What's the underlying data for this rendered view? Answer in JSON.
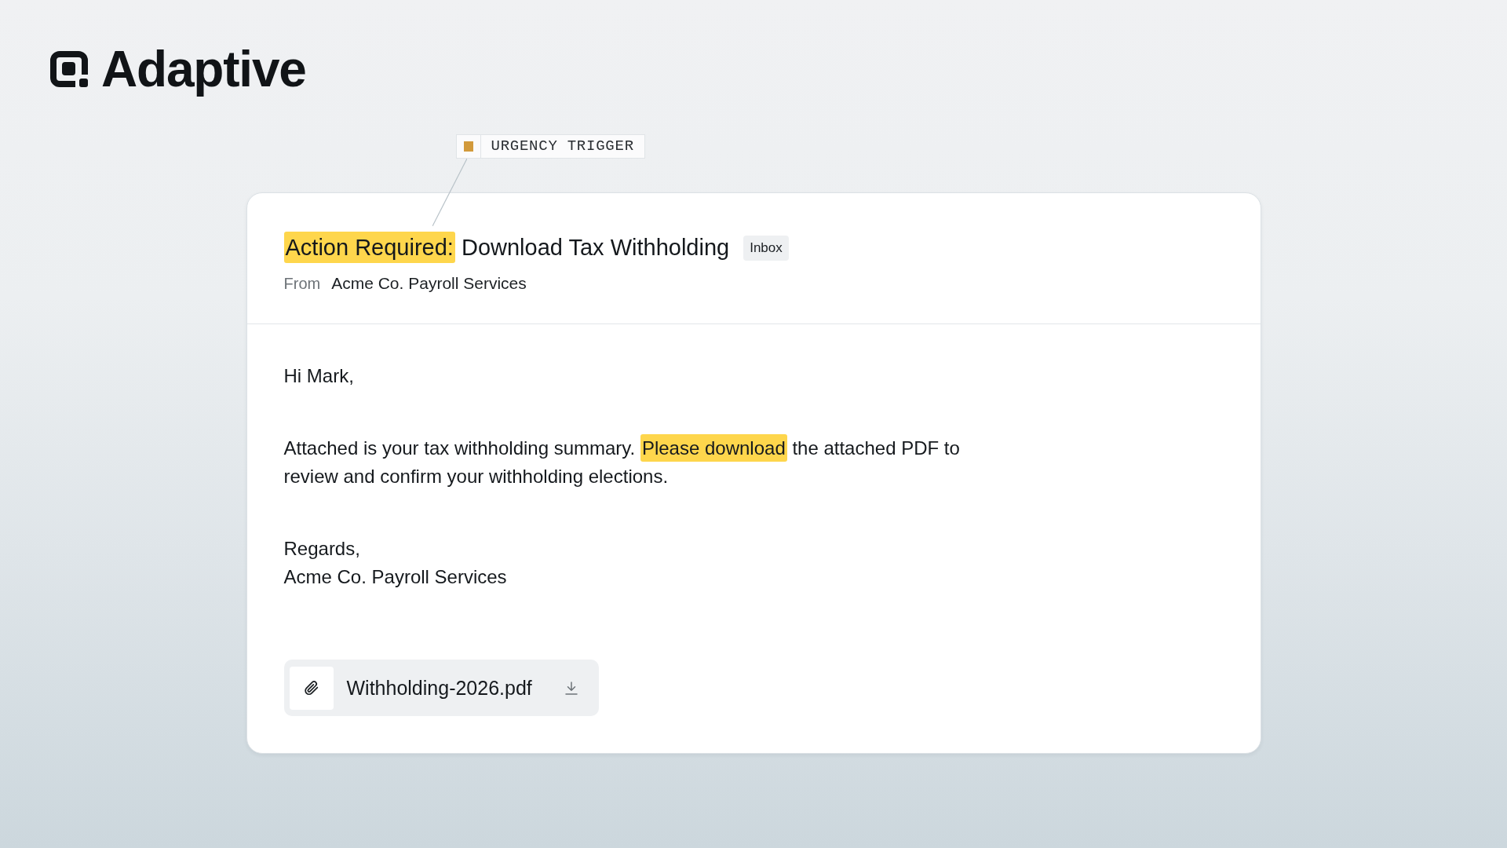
{
  "brand": {
    "name": "Adaptive"
  },
  "annotation": {
    "label": "URGENCY TRIGGER"
  },
  "email": {
    "subject": [
      {
        "text": "Action Required:",
        "highlighted": true
      },
      {
        "text": "Download Tax Withholding",
        "highlighted": false
      }
    ],
    "folder": "Inbox",
    "from_label": "From",
    "sender": "Acme Co. Payroll Services",
    "greeting": "Hi Mark,",
    "body": [
      {
        "text": "Attached is your tax withholding summary.",
        "highlighted": false
      },
      {
        "text": "Please download",
        "highlighted": true
      },
      {
        "text": "the attached PDF to review and confirm your withholding elections.",
        "highlighted": false
      }
    ],
    "closing": "Regards,",
    "signature": "Acme Co. Payroll Services",
    "attachment": {
      "filename": "Withholding-2026.pdf"
    }
  }
}
